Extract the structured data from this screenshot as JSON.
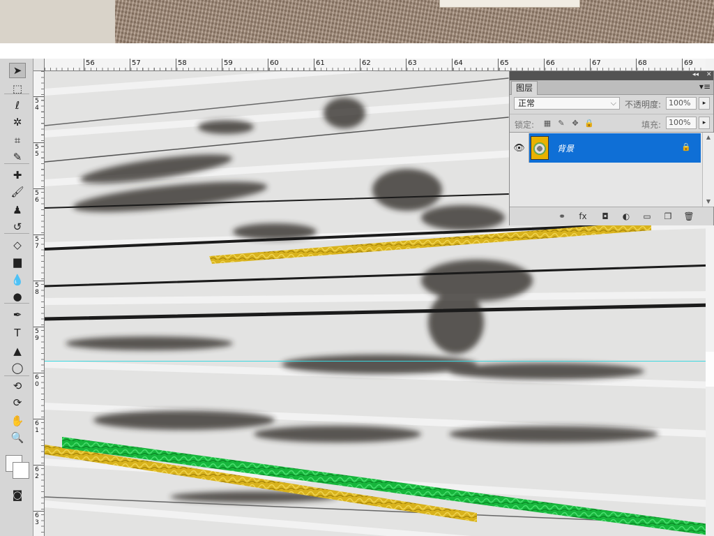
{
  "ruler": {
    "top_numbers": [
      "56",
      "57",
      "58",
      "59",
      "60",
      "61",
      "62",
      "63",
      "64",
      "65",
      "66",
      "67",
      "68",
      "69"
    ],
    "left_numbers": [
      {
        "a": "5",
        "b": "4"
      },
      {
        "a": "5",
        "b": "5"
      },
      {
        "a": "5",
        "b": "6"
      },
      {
        "a": "5",
        "b": "7"
      },
      {
        "a": "5",
        "b": "8"
      },
      {
        "a": "5",
        "b": "9"
      },
      {
        "a": "6",
        "b": "0"
      },
      {
        "a": "6",
        "b": "1"
      },
      {
        "a": "6",
        "b": "2"
      },
      {
        "a": "6",
        "b": "3"
      }
    ]
  },
  "tools": [
    {
      "name": "move-tool",
      "icon": "move-icon",
      "glyph": "➤"
    },
    {
      "name": "marquee-tool",
      "icon": "rect-marquee-icon",
      "glyph": "⬚"
    },
    {
      "name": "lasso-tool",
      "icon": "lasso-icon",
      "glyph": "ℓ"
    },
    {
      "name": "magic-wand-tool",
      "icon": "magic-wand-icon",
      "glyph": "✲"
    },
    {
      "name": "crop-tool",
      "icon": "crop-icon",
      "glyph": "⌗"
    },
    {
      "name": "eyedropper-tool",
      "icon": "eyedropper-icon",
      "glyph": "✎"
    },
    {
      "name": "healing-brush-tool",
      "icon": "bandage-icon",
      "glyph": "✚"
    },
    {
      "name": "brush-tool",
      "icon": "brush-icon",
      "glyph": "🖌"
    },
    {
      "name": "clone-stamp-tool",
      "icon": "stamp-icon",
      "glyph": "♟"
    },
    {
      "name": "history-brush-tool",
      "icon": "history-brush-icon",
      "glyph": "↺"
    },
    {
      "name": "eraser-tool",
      "icon": "eraser-icon",
      "glyph": "◇"
    },
    {
      "name": "gradient-tool",
      "icon": "gradient-icon",
      "glyph": "▆"
    },
    {
      "name": "blur-tool",
      "icon": "drop-icon",
      "glyph": "💧"
    },
    {
      "name": "dodge-tool",
      "icon": "dodge-icon",
      "glyph": "●"
    },
    {
      "name": "pen-tool",
      "icon": "pen-icon",
      "glyph": "✒"
    },
    {
      "name": "type-tool",
      "icon": "type-icon",
      "glyph": "T"
    },
    {
      "name": "path-selection-tool",
      "icon": "arrow-icon",
      "glyph": "▲"
    },
    {
      "name": "shape-tool",
      "icon": "ellipse-icon",
      "glyph": "◯"
    },
    {
      "name": "3d-rotate-tool",
      "icon": "3d-rotate-icon",
      "glyph": "⟲"
    },
    {
      "name": "3d-orbit-tool",
      "icon": "3d-orbit-icon",
      "glyph": "⟳"
    },
    {
      "name": "hand-tool",
      "icon": "hand-icon",
      "glyph": "✋"
    },
    {
      "name": "zoom-tool",
      "icon": "zoom-icon",
      "glyph": "🔍"
    }
  ],
  "layers_panel": {
    "tab_label": "图层",
    "blend_mode": "正常",
    "opacity_label": "不透明度:",
    "opacity_value": "100%",
    "lock_label": "锁定:",
    "fill_label": "填充:",
    "fill_value": "100%",
    "layer_name": "背景",
    "panel_controls": [
      "◂◂",
      "✕"
    ],
    "menu_icon": "▾≡",
    "footer_icons": [
      {
        "name": "link-layers-icon",
        "glyph": "⚭"
      },
      {
        "name": "fx-icon",
        "glyph": "fx"
      },
      {
        "name": "add-mask-icon",
        "glyph": "◘"
      },
      {
        "name": "adjustment-layer-icon",
        "glyph": "◐"
      },
      {
        "name": "new-group-icon",
        "glyph": "▭"
      },
      {
        "name": "new-layer-icon",
        "glyph": "❐"
      },
      {
        "name": "delete-layer-icon",
        "glyph": "🗑"
      }
    ]
  },
  "colors": {
    "selected_layer": "#0f6fd6",
    "gold_stripe": "#d8b21c",
    "green_stripe": "#17b63c",
    "guide_line": "#3ad8e0"
  }
}
